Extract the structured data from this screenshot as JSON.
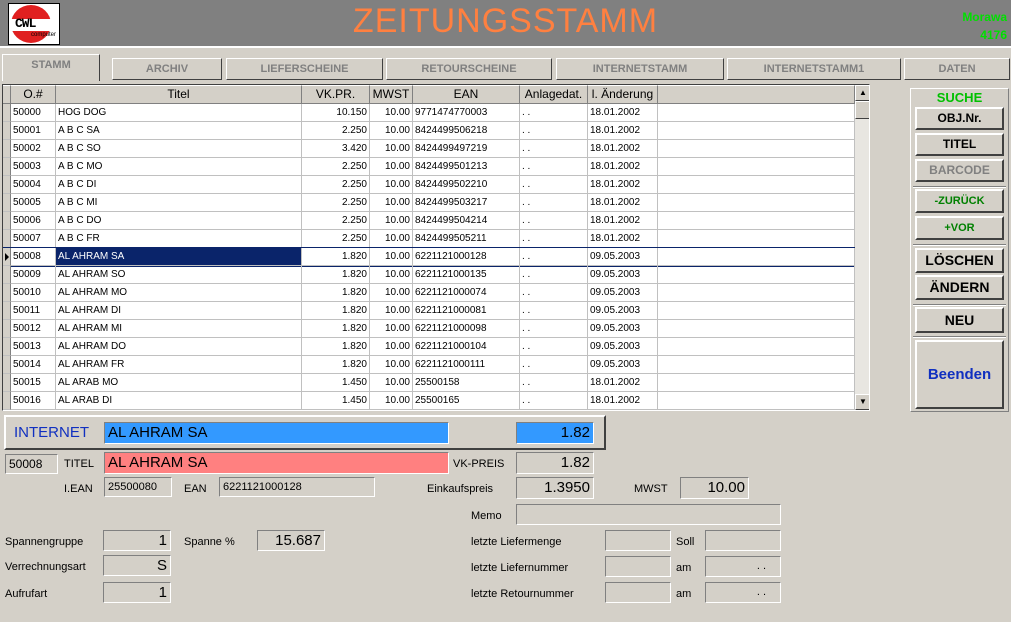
{
  "header": {
    "title": "ZEITUNGSSTAMM",
    "logo_text": "CWL",
    "logo_sub": "computer",
    "user_name": "Morawa",
    "user_code": "4176"
  },
  "tabs": [
    "STAMM",
    "ARCHIV",
    "LIEFERSCHEINE",
    "RETOURSCHEINE",
    "INTERNETSTAMM",
    "INTERNETSTAMM1",
    "DATEN"
  ],
  "table": {
    "columns": [
      "O.#",
      "Titel",
      "VK.PR.",
      "MWST",
      "EAN",
      "Anlagedat.",
      "l. Änderung"
    ],
    "selected_index": 8,
    "rows": [
      [
        "50000",
        "HOG DOG",
        "10.150",
        "10.00",
        "9771474770003",
        ". .",
        "18.01.2002"
      ],
      [
        "50001",
        "A B C    SA",
        "2.250",
        "10.00",
        "8424499506218",
        ". .",
        "18.01.2002"
      ],
      [
        "50002",
        "A B C    SO",
        "3.420",
        "10.00",
        "8424499497219",
        ". .",
        "18.01.2002"
      ],
      [
        "50003",
        "A B C    MO",
        "2.250",
        "10.00",
        "8424499501213",
        ". .",
        "18.01.2002"
      ],
      [
        "50004",
        "A B C    DI",
        "2.250",
        "10.00",
        "8424499502210",
        ". .",
        "18.01.2002"
      ],
      [
        "50005",
        "A B C    MI",
        "2.250",
        "10.00",
        "8424499503217",
        ". .",
        "18.01.2002"
      ],
      [
        "50006",
        "A B C    DO",
        "2.250",
        "10.00",
        "8424499504214",
        ". .",
        "18.01.2002"
      ],
      [
        "50007",
        "A B C    FR",
        "2.250",
        "10.00",
        "8424499505211",
        ". .",
        "18.01.2002"
      ],
      [
        "50008",
        "AL AHRAM SA",
        "1.820",
        "10.00",
        "6221121000128",
        ". .",
        "09.05.2003"
      ],
      [
        "50009",
        "AL AHRAM SO",
        "1.820",
        "10.00",
        "6221121000135",
        ". .",
        "09.05.2003"
      ],
      [
        "50010",
        "AL AHRAM MO",
        "1.820",
        "10.00",
        "6221121000074",
        ". .",
        "09.05.2003"
      ],
      [
        "50011",
        "AL AHRAM DI",
        "1.820",
        "10.00",
        "6221121000081",
        ". .",
        "09.05.2003"
      ],
      [
        "50012",
        "AL AHRAM MI",
        "1.820",
        "10.00",
        "6221121000098",
        ". .",
        "09.05.2003"
      ],
      [
        "50013",
        "AL AHRAM DO",
        "1.820",
        "10.00",
        "6221121000104",
        ". .",
        "09.05.2003"
      ],
      [
        "50014",
        "AL AHRAM FR",
        "1.820",
        "10.00",
        "6221121000111",
        ". .",
        "09.05.2003"
      ],
      [
        "50015",
        "AL ARAB MO",
        "1.450",
        "10.00",
        "25500158",
        ". .",
        "18.01.2002"
      ],
      [
        "50016",
        "AL ARAB DI",
        "1.450",
        "10.00",
        "25500165",
        ". .",
        "18.01.2002"
      ]
    ]
  },
  "sidebar": {
    "suche_label": "SUCHE",
    "objnr": "OBJ.Nr.",
    "titel": "TITEL",
    "barcode": "BARCODE",
    "zurueck": "-ZURÜCK",
    "vor": "+VOR",
    "loeschen": "LÖSCHEN",
    "aendern": "ÄNDERN",
    "neu": "NEU",
    "beenden": "Beenden"
  },
  "form": {
    "internet_label": "INTERNET",
    "internet_title": "AL AHRAM SA",
    "internet_price": "1.82",
    "objnr": "50008",
    "titel_label": "TITEL",
    "titel_value": "AL AHRAM SA",
    "vkpreis_label": "VK-PREIS",
    "vkpreis_value": "1.82",
    "iean_label": "I.EAN",
    "iean_value": "25500080",
    "ean_label": "EAN",
    "ean_value": "6221121000128",
    "einkaufspreis_label": "Einkaufspreis",
    "einkaufspreis_value": "1.3950",
    "mwst_label": "MWST",
    "mwst_value": "10.00",
    "memo_label": "Memo",
    "memo_value": "",
    "spannengruppe_label": "Spannengruppe",
    "spannengruppe_value": "1",
    "spanne_label": "Spanne %",
    "spanne_value": "15.687",
    "verrechnungsart_label": "Verrechnungsart",
    "verrechnungsart_value": "S",
    "aufrufart_label": "Aufrufart",
    "aufrufart_value": "1",
    "liefermenge_label": "letzte Liefermenge",
    "liefermenge_value": "",
    "soll_label": "Soll",
    "soll_value": "",
    "liefernummer_label": "letzte Liefernummer",
    "liefernummer_value": "",
    "am_label": "am",
    "liefer_am_value": ". .",
    "retournummer_label": "letzte Retournummer",
    "retournummer_value": "",
    "retour_am_value": ". ."
  }
}
